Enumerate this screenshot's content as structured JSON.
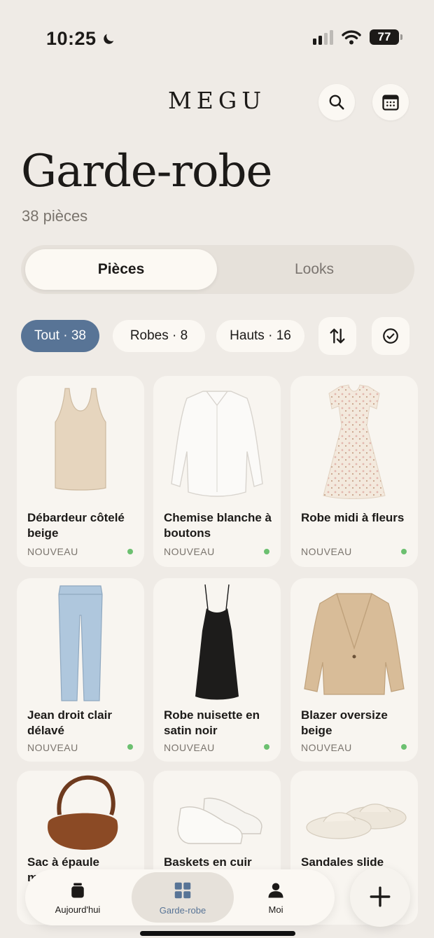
{
  "status_bar": {
    "time": "10:25",
    "battery": "77"
  },
  "header": {
    "brand": "MEGU",
    "search_icon": "search-icon",
    "calendar_icon": "calendar-icon"
  },
  "page": {
    "title": "Garde-robe",
    "subtitle": "38 pièces"
  },
  "segmented": {
    "active": "Pièces",
    "inactive": "Looks"
  },
  "filters": {
    "chips": [
      "Tout · 38",
      "Robes · 8",
      "Hauts · 16"
    ],
    "sort_icon": "sort-icon",
    "select_icon": "check-circle-icon"
  },
  "colors": {
    "accent": "#587496",
    "background": "#EFEBE6",
    "new_dot": "#6CC070"
  },
  "items": [
    {
      "name": "Débardeur côtelé beige",
      "badge": "NOUVEAU",
      "icon": "tank-top"
    },
    {
      "name": "Chemise blanche à boutons",
      "badge": "NOUVEAU",
      "icon": "shirt"
    },
    {
      "name": "Robe midi à fleurs",
      "badge": "NOUVEAU",
      "icon": "floral-dress"
    },
    {
      "name": "Jean droit clair délavé",
      "badge": "NOUVEAU",
      "icon": "jeans"
    },
    {
      "name": "Robe nuisette en satin noir",
      "badge": "NOUVEAU",
      "icon": "slip-dress"
    },
    {
      "name": "Blazer oversize beige",
      "badge": "NOUVEAU",
      "icon": "blazer"
    },
    {
      "name": "Sac à épaule marron",
      "icon": "shoulder-bag"
    },
    {
      "name": "Baskets en cuir",
      "icon": "sneakers"
    },
    {
      "name": "Sandales slide",
      "icon": "slides"
    }
  ],
  "nav": {
    "today": "Aujourd'hui",
    "wardrobe": "Garde-robe",
    "me": "Moi",
    "add_icon": "plus-icon"
  }
}
